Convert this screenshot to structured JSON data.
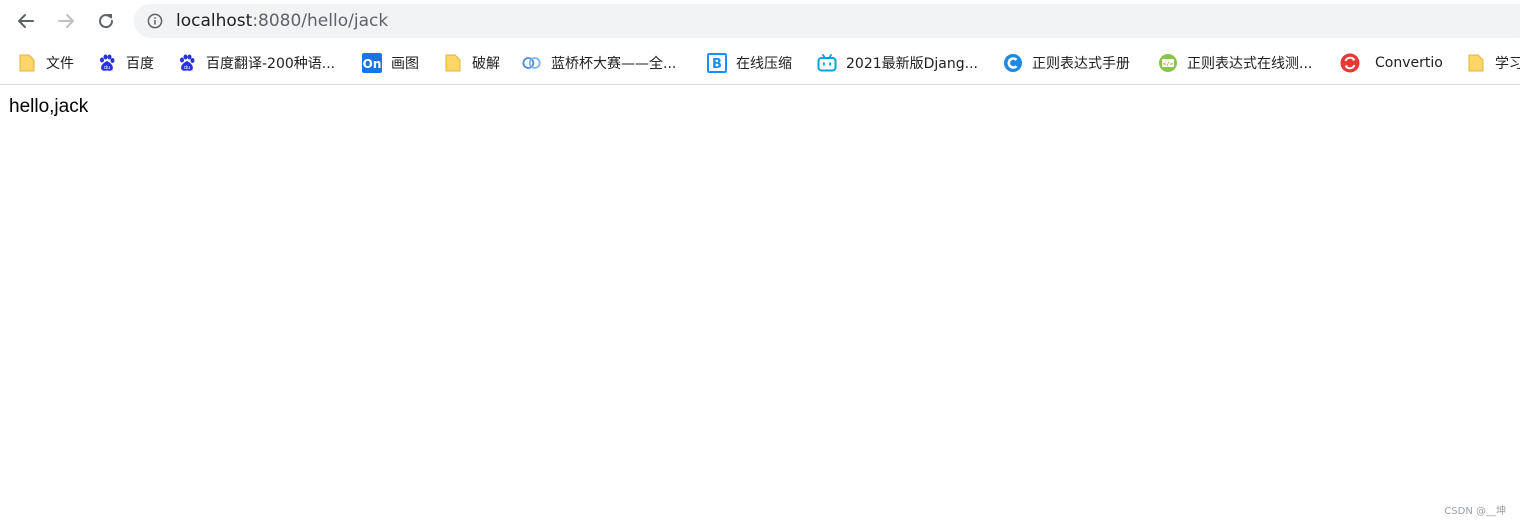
{
  "browser": {
    "url_host": "localhost",
    "url_rest": ":8080/hello/jack"
  },
  "bookmarks": [
    {
      "label": "文件",
      "icon": "folder-icon"
    },
    {
      "label": "百度",
      "icon": "baidu-icon"
    },
    {
      "label": "百度翻译-200种语...",
      "icon": "baidu-icon"
    },
    {
      "label": "画图",
      "icon": "on-icon"
    },
    {
      "label": "破解",
      "icon": "folder-icon"
    },
    {
      "label": "蓝桥杯大赛——全...",
      "icon": "lanqiao-icon"
    },
    {
      "label": "在线压缩",
      "icon": "b-icon"
    },
    {
      "label": "2021最新版Djang...",
      "icon": "bilibili-icon"
    },
    {
      "label": "正则表达式手册",
      "icon": "c-icon"
    },
    {
      "label": "正则表达式在线测...",
      "icon": "code-icon"
    },
    {
      "label": "Convertio",
      "icon": "convertio-icon"
    },
    {
      "label": "学习",
      "icon": "folder-icon"
    }
  ],
  "page": {
    "text": "hello,jack"
  },
  "watermark": "CSDN @__坤",
  "colors": {
    "folder": "#fdd663",
    "baidu": "#2932e1",
    "on": "#1a73e8",
    "b_icon": "#1890ff",
    "bilibili": "#00a1d6",
    "c_icon": "#1e88e5",
    "code_icon": "#8bc34a",
    "convertio": "#e53935"
  }
}
